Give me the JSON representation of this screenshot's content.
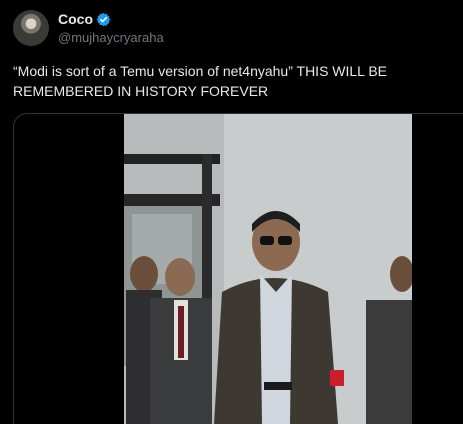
{
  "post": {
    "author": {
      "display_name": "Coco",
      "handle": "@mujhaycryaraha",
      "verified": true
    },
    "text": "“Modi is sort of a Temu version of net4nyahu” THIS WILL BE\nREMEMBERED IN HISTORY FOREVER"
  },
  "colors": {
    "background": "#000000",
    "text": "#e7e9ea",
    "secondary_text": "#71767b",
    "verified_badge": "#1d9bf0",
    "card_border": "#2f3336"
  },
  "icons": {
    "verified": "verified-badge-icon"
  }
}
